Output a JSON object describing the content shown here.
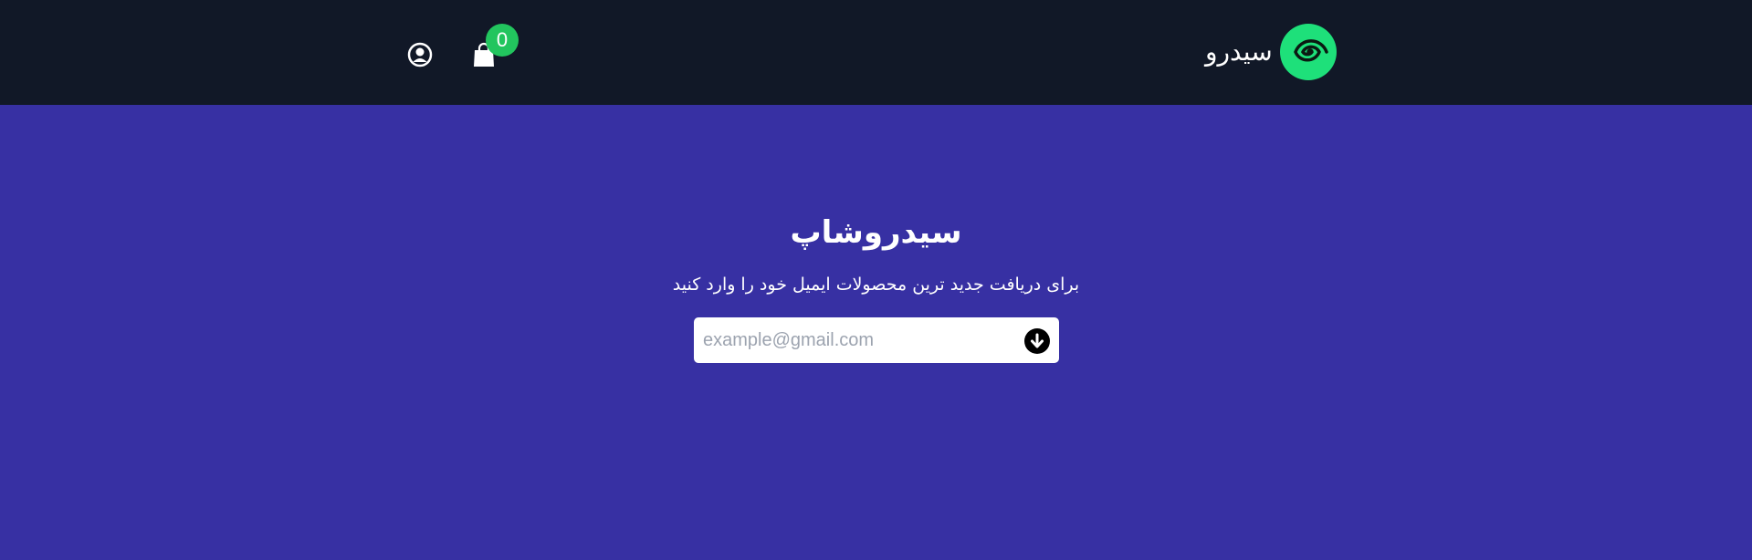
{
  "header": {
    "brand_name": "سیدرو",
    "cart_count": "0",
    "icons": {
      "logo": "spiral-logo-icon",
      "cart": "shopping-bag-icon",
      "user": "user-circle-icon"
    }
  },
  "hero": {
    "title": "سیدروشاپ",
    "subtitle": "برای دریافت جدید ترین محصولات ایمیل خود را وارد کنید",
    "email_placeholder": "example@gmail.com",
    "submit_icon": "arrow-down-circle-icon"
  },
  "colors": {
    "navbar_bg": "#111827",
    "hero_bg": "#3730a3",
    "brand_accent": "#1ee07a",
    "badge_bg": "#22c55e",
    "text": "#ffffff"
  }
}
